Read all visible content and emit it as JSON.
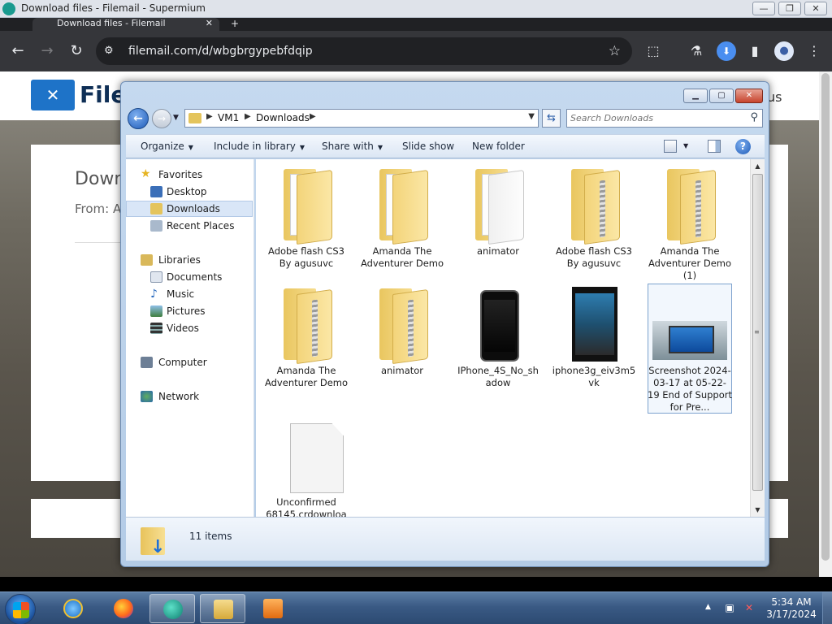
{
  "browser": {
    "window_title": "Download files - Filemail - Supermium",
    "tab_title": "Download files - Filemail",
    "url": "filemail.com/d/wbgbrgypebfdqip",
    "window_controls": {
      "minimize": "—",
      "maximize": "❐",
      "close": "✕"
    },
    "tab_close": "✕",
    "new_tab": "+"
  },
  "page": {
    "logo_text": "File",
    "header_right": "us",
    "card_title": "Down",
    "card_from": "From: A"
  },
  "explorer": {
    "breadcrumb": [
      "VM1",
      "Downloads"
    ],
    "search_placeholder": "Search Downloads",
    "commands": {
      "organize": "Organize",
      "include_in_library": "Include in library",
      "share_with": "Share with",
      "slide_show": "Slide show",
      "new_folder": "New folder"
    },
    "nav": {
      "favorites": "Favorites",
      "desktop": "Desktop",
      "downloads": "Downloads",
      "recent_places": "Recent Places",
      "libraries": "Libraries",
      "documents": "Documents",
      "music": "Music",
      "pictures": "Pictures",
      "videos": "Videos",
      "computer": "Computer",
      "network": "Network"
    },
    "items": [
      {
        "name": "Adobe flash CS3 By agusuvc",
        "kind": "folder"
      },
      {
        "name": "Amanda The Adventurer Demo",
        "kind": "folder"
      },
      {
        "name": "animator",
        "kind": "folder"
      },
      {
        "name": "Adobe flash CS3 By agusuvc",
        "kind": "zip"
      },
      {
        "name": "Amanda The Adventurer Demo (1)",
        "kind": "zip"
      },
      {
        "name": "Amanda The Adventurer Demo",
        "kind": "zip"
      },
      {
        "name": "animator",
        "kind": "zip"
      },
      {
        "name": "IPhone_4S_No_shadow",
        "kind": "image-phone"
      },
      {
        "name": "iphone3g_eiv3m5vk",
        "kind": "image-phone2"
      },
      {
        "name": "Screenshot 2024-03-17 at 05-22-19 End of Support for Pre...",
        "kind": "image-laptop"
      },
      {
        "name": "Unconfirmed 68145.crdownloa",
        "kind": "file"
      }
    ],
    "status_count": "11 items"
  },
  "taskbar": {
    "time": "5:34 AM",
    "date": "3/17/2024"
  }
}
